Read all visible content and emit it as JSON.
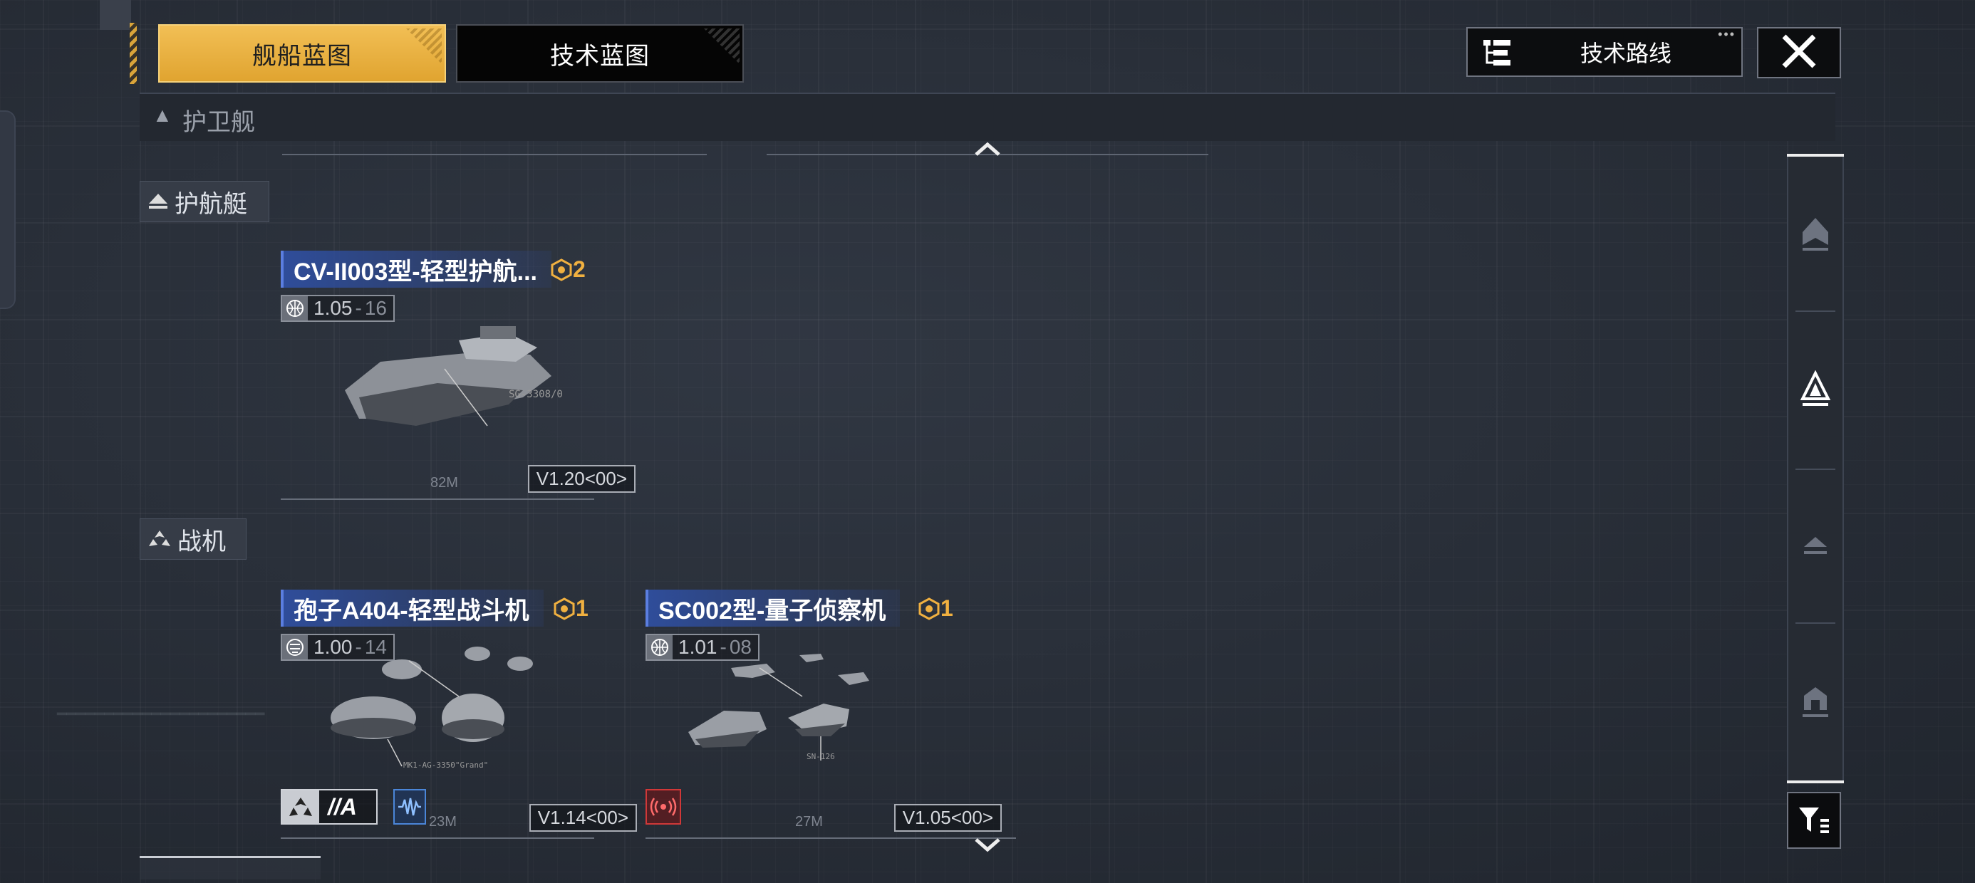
{
  "tabs": {
    "ship_blueprint": "舰船蓝图",
    "tech_blueprint": "技术蓝图",
    "active": "ship_blueprint"
  },
  "toolbar": {
    "tech_route": "技术路线"
  },
  "sections": {
    "frigate": "护卫舰",
    "corvette": "护航艇",
    "fighter": "战机"
  },
  "cards": [
    {
      "name": "CV-II003型-轻型护航...",
      "count": "2",
      "version": "1.05",
      "version_sub": "16",
      "length": "82M",
      "build_tag": "V1.20<00>",
      "part_label": "SG-3308/0"
    },
    {
      "name": "孢子A404-轻型战斗机",
      "count": "1",
      "version": "1.00",
      "version_sub": "14",
      "length": "23M",
      "build_tag": "V1.14<00>",
      "role_badge": "//A",
      "part_label": "MK1-AG-3350\"Grand\""
    },
    {
      "name": "SC002型-量子侦察机",
      "count": "1",
      "version": "1.01",
      "version_sub": "08",
      "length": "27M",
      "build_tag": "V1.05<00>",
      "part_label": "SN-126"
    }
  ],
  "colors": {
    "accent_gold": "#e6aa35",
    "name_blue": "#2f4d9a",
    "count_gold": "#f0b040",
    "warning_red": "#d03838",
    "wave_blue": "#4b86d8"
  }
}
